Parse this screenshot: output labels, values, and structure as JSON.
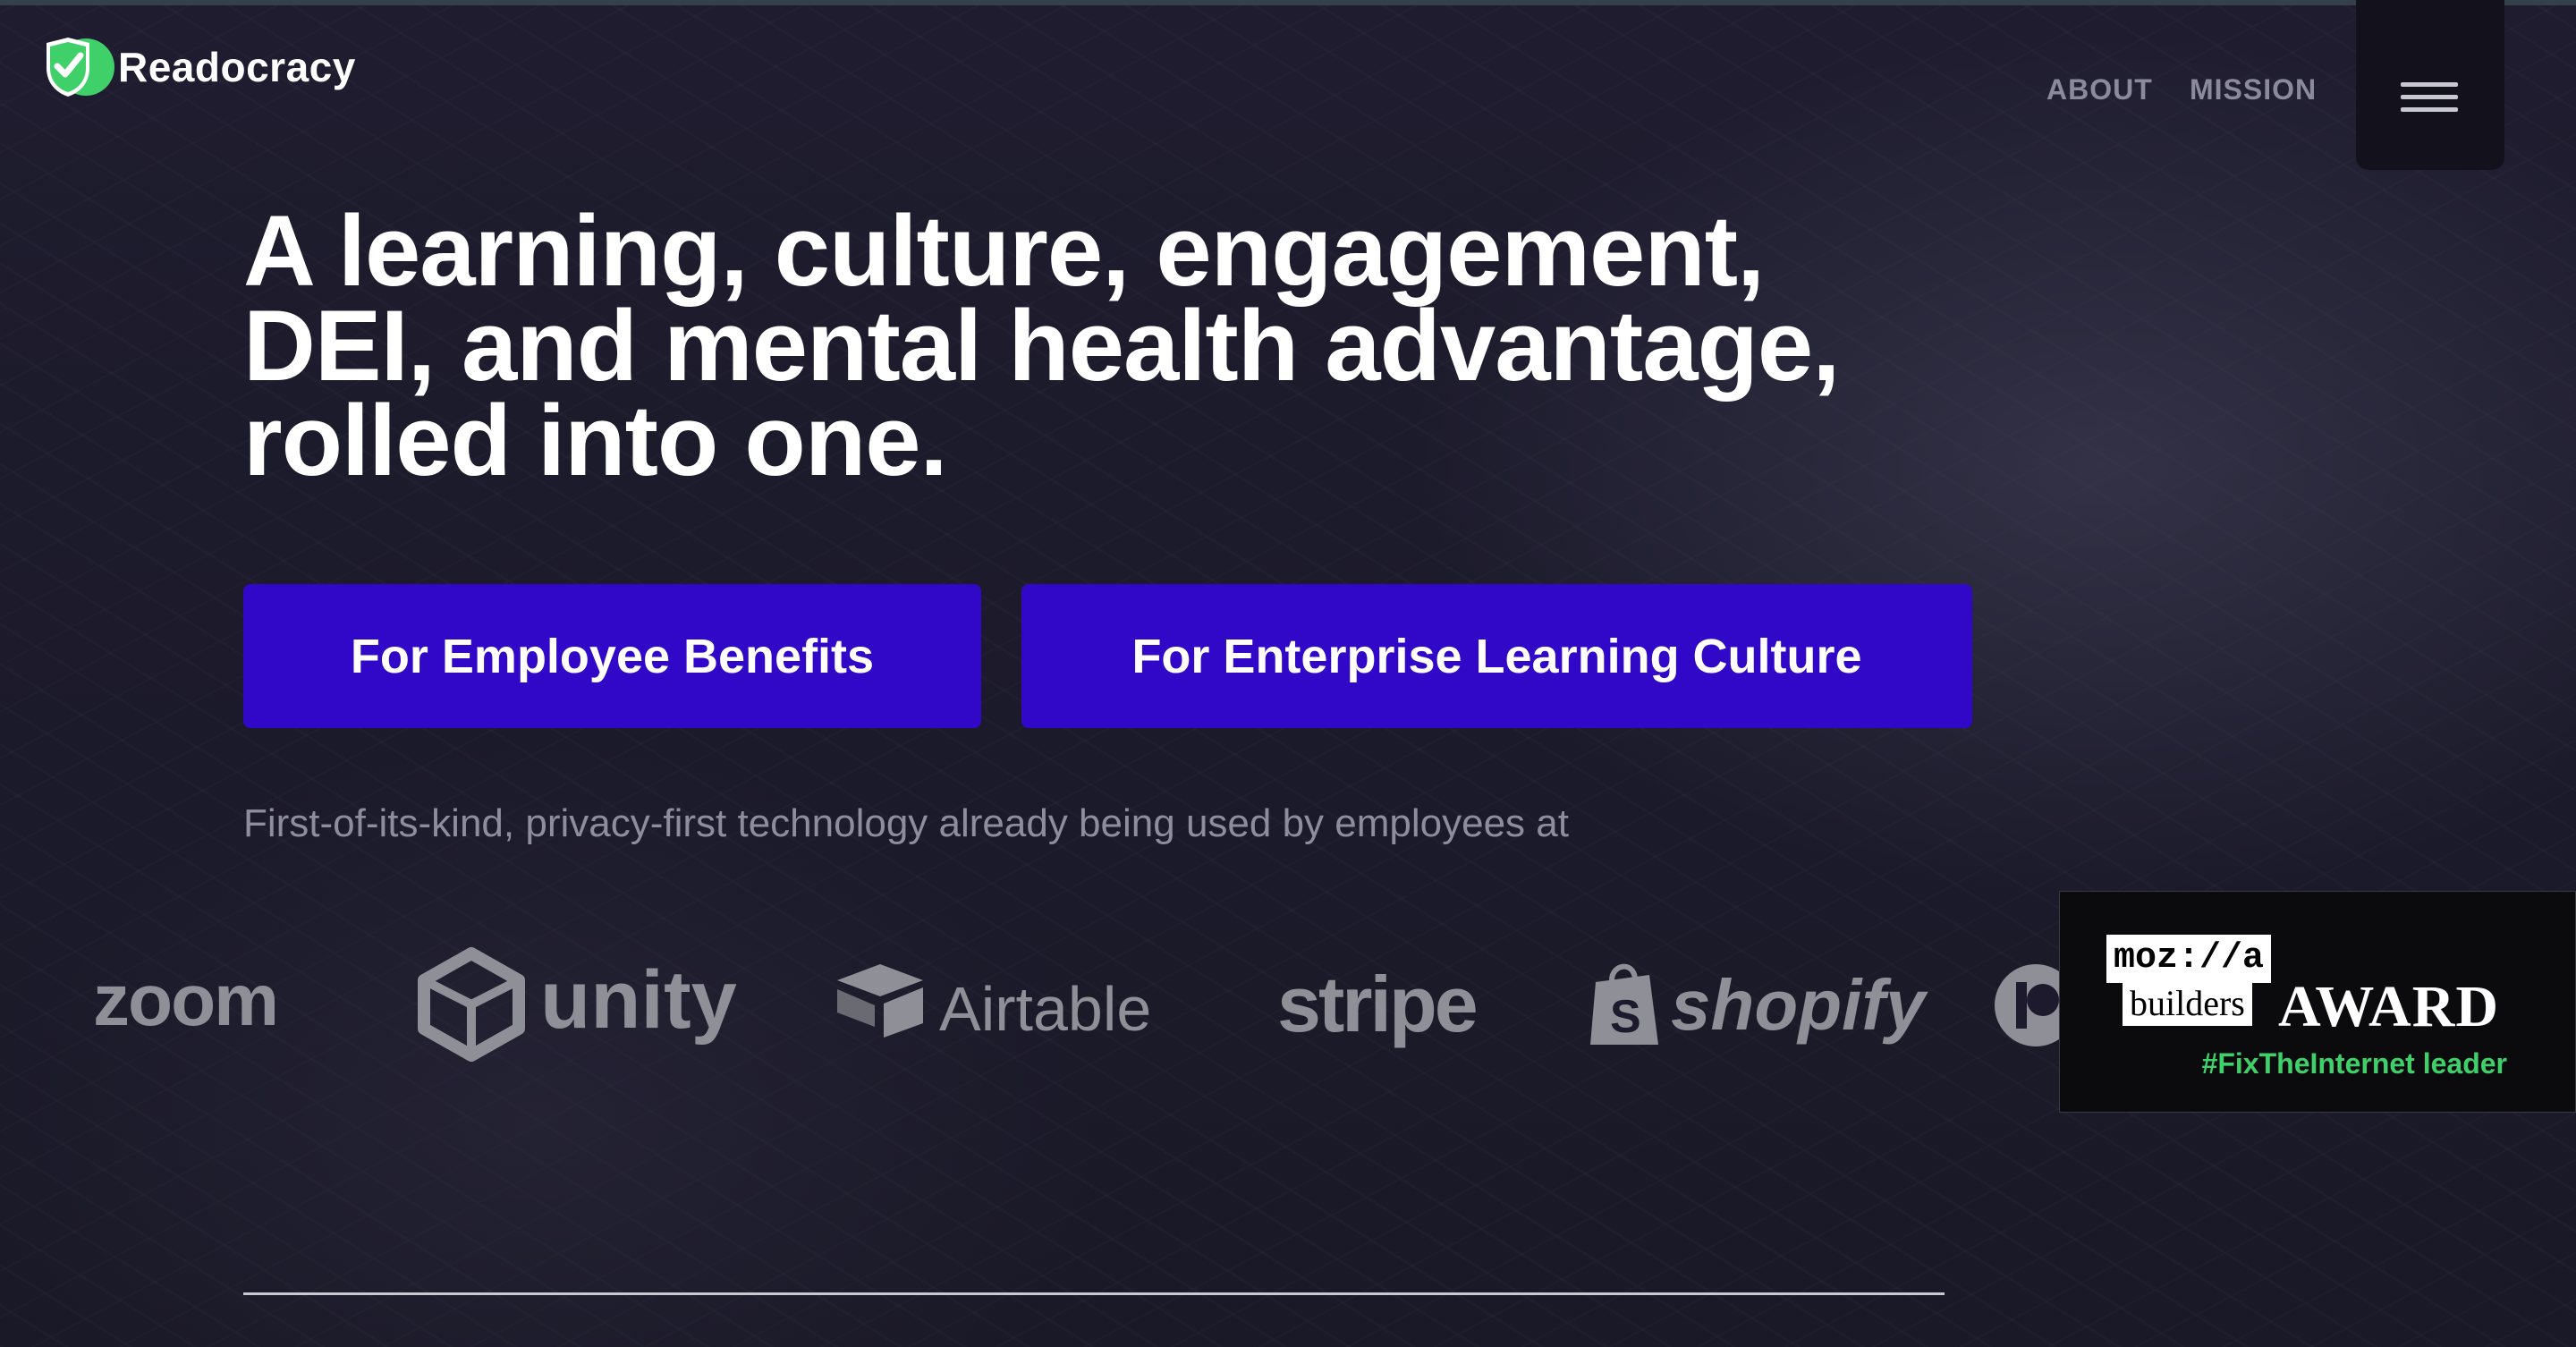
{
  "brand": {
    "name": "Readocracy",
    "accent": "#3fd06a"
  },
  "nav": {
    "about": "ABOUT",
    "mission": "MISSION",
    "menu_icon": "hamburger-menu-icon"
  },
  "hero": {
    "headline_lines": [
      "A learning, culture, engagement,",
      "DEI, and mental health advantage,",
      "rolled into one."
    ],
    "cta_primary": "For Employee Benefits",
    "cta_secondary": "For Enterprise Learning Culture",
    "cta_color": "#3208c8",
    "tagline": "First-of-its-kind, privacy-first technology already being used by employees at"
  },
  "clients": {
    "logos": [
      "zoom",
      "unity",
      "Airtable",
      "stripe",
      "shopify"
    ]
  },
  "award": {
    "moz": "moz://a",
    "builders": "builders",
    "award": "AWARD",
    "hashtag": "#FixTheInternet leader"
  }
}
